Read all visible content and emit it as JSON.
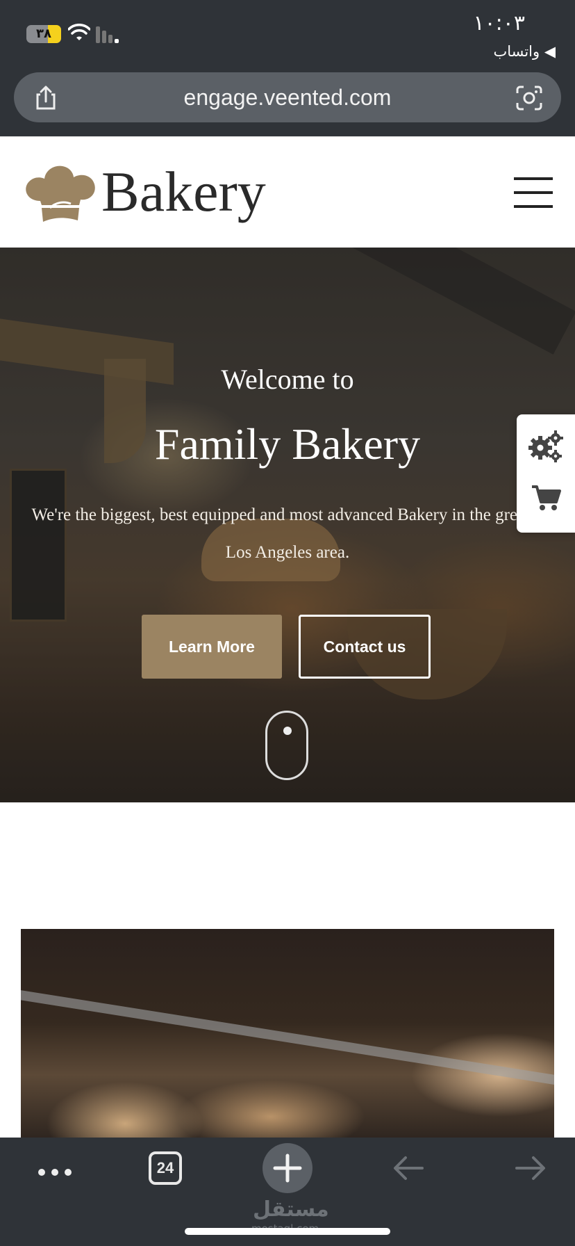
{
  "status_bar": {
    "time": "١٠:٠٣",
    "back_app": "◀ واتساب",
    "battery_level": "٣٨",
    "battery_fraction": 0.38,
    "icons": [
      "battery-icon",
      "wifi-icon",
      "cellular-signal-icon"
    ]
  },
  "browser": {
    "url": "engage.veented.com",
    "tab_count": "24",
    "icons": [
      "share-icon",
      "lens-icon",
      "more-icon",
      "tabs-icon",
      "plus-icon",
      "back-arrow-icon",
      "forward-arrow-icon"
    ]
  },
  "site": {
    "logo_text": "Bakery",
    "brand_color": "#9b8462",
    "hero": {
      "welcome": "Welcome to",
      "title": "Family Bakery",
      "description": "We're the biggest, best equipped and most advanced Bakery in the greater Los Angeles area.",
      "learn_more": "Learn More",
      "contact_us": "Contact us"
    },
    "side_widget": [
      "gears-icon",
      "cart-icon"
    ]
  },
  "watermark": {
    "arabic": "مستقل",
    "latin": "mostaql.com"
  }
}
